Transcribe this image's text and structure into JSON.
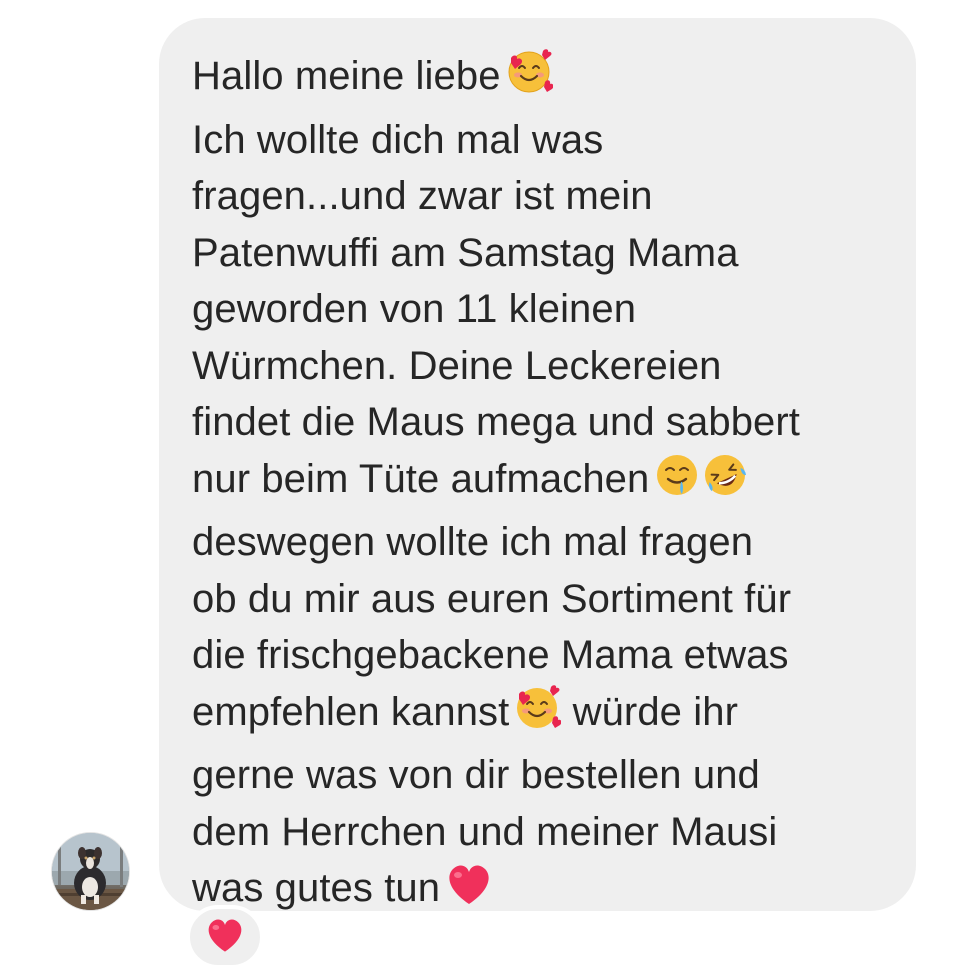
{
  "message": {
    "lines": [
      {
        "text": "Hallo meine liebe",
        "emojis": [
          "smiling-face-with-hearts-emoji"
        ]
      },
      {
        "text": "Ich wollte dich mal was",
        "emojis": []
      },
      {
        "text": "fragen...und zwar ist mein",
        "emojis": []
      },
      {
        "text": "Patenwuffi am Samstag Mama",
        "emojis": []
      },
      {
        "text": "geworden von 11 kleinen",
        "emojis": []
      },
      {
        "text": "Würmchen. Deine Leckereien",
        "emojis": []
      },
      {
        "text": "findet die Maus mega und sabbert",
        "emojis": []
      },
      {
        "text": "nur beim Tüte aufmachen",
        "emojis": [
          "drooling-face-emoji",
          "rolling-on-floor-laughing-emoji"
        ]
      },
      {
        "text": "deswegen wollte ich mal fragen",
        "emojis": []
      },
      {
        "text": "ob du mir aus euren Sortiment für",
        "emojis": []
      },
      {
        "text": "die frischgebackene Mama etwas",
        "emojis": []
      },
      {
        "text": "empfehlen kannst",
        "emojis": [
          "smiling-face-with-hearts-emoji"
        ],
        "after": " würde ihr"
      },
      {
        "text": "gerne was von dir bestellen und",
        "emojis": []
      },
      {
        "text": "dem Herrchen und meiner Mausi",
        "emojis": []
      },
      {
        "text": "was gutes tun",
        "emojis": [
          "red-heart-emoji"
        ]
      }
    ],
    "bubble_color": "#efefef",
    "text_color": "#262626"
  },
  "reaction": {
    "emoji": "red-heart-emoji",
    "color": "#e8254f"
  },
  "avatar": {
    "icon": "dog-profile-avatar"
  }
}
